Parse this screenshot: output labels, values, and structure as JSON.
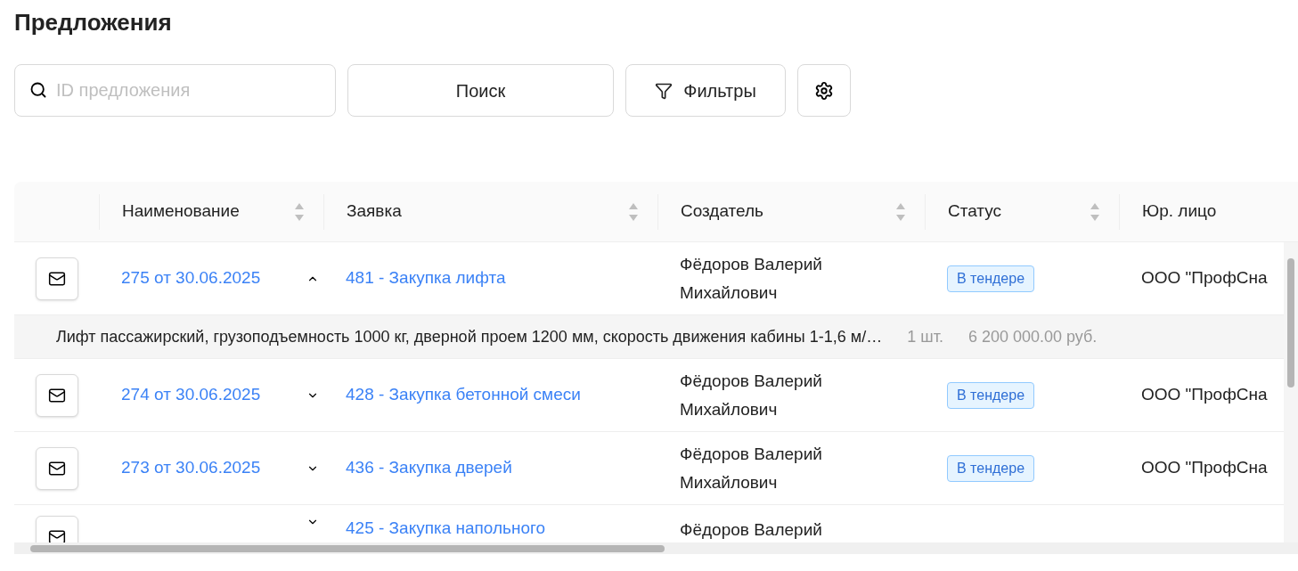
{
  "title": "Предложения",
  "search": {
    "placeholder": "ID предложения"
  },
  "buttons": [
    {
      "kind": "search",
      "label": "Поиск"
    },
    {
      "kind": "filters",
      "label": "Фильтры"
    },
    {
      "kind": "settings"
    }
  ],
  "table": {
    "columns": [
      {
        "label": "Наименование",
        "sortable": true
      },
      {
        "label": "Заявка",
        "sortable": true
      },
      {
        "label": "Создатель",
        "sortable": true
      },
      {
        "label": "Статус",
        "sortable": true
      },
      {
        "label": "Юр. лицо",
        "sortable": false
      }
    ],
    "rows": [
      {
        "name": "275 от 30.06.2025",
        "expanded": true,
        "request": "481 - Закупка лифта",
        "creator": "Фёдоров Валерий Михайлович",
        "status": "В тендере",
        "company": "ООО \"ПрофСна",
        "detail": {
          "description": "Лифт пассажирский, грузоподъемность 1000 кг, дверной проем 1200 мм, скорость движения кабины 1-1,6 м/…",
          "quantity": "1 шт.",
          "price": "6 200 000.00 руб."
        }
      },
      {
        "name": "274 от 30.06.2025",
        "expanded": false,
        "request": "428 - Закупка бетонной смеси",
        "creator": "Фёдоров Валерий Михайлович",
        "status": "В тендере",
        "company": "ООО \"ПрофСна"
      },
      {
        "name": "273 от 30.06.2025",
        "expanded": false,
        "request": "436 - Закупка дверей",
        "creator": "Фёдоров Валерий Михайлович",
        "status": "В тендере",
        "company": "ООО \"ПрофСна"
      },
      {
        "expanded": false,
        "request": "425 - Закупка напольного",
        "creator": "Фёдоров Валерий"
      }
    ]
  }
}
